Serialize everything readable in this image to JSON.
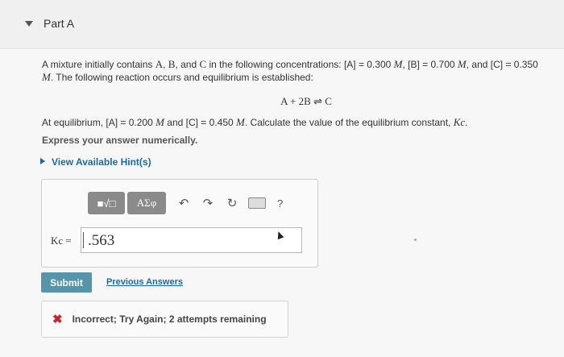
{
  "header": {
    "title": "Part A"
  },
  "problem": {
    "p1_intro": "A mixture initially contains ",
    "species": [
      "A",
      "B",
      "C"
    ],
    "p1_mid": " in the following concentrations: ",
    "conc_init": {
      "A": "0.300",
      "B": "0.700",
      "C": "0.350"
    },
    "unit": "M",
    "p1_end": ". The following reaction occurs and equilibrium is established:",
    "reaction": "A + 2B ⇌ C",
    "p2_start": "At equilibrium, ",
    "conc_eq": {
      "A": "0.200",
      "C": "0.450"
    },
    "p2_end": ". Calculate the value of the equilibrium constant, ",
    "kc": "Kc",
    "instruction": "Express your answer numerically."
  },
  "hint_label": "View Available Hint(s)",
  "toolbar": {
    "b1": "■√□",
    "b2": "ΑΣφ",
    "undo": "↶",
    "redo": "↷",
    "reset": "↻",
    "help": "?"
  },
  "answer": {
    "label": "Kc =",
    "value": ".563"
  },
  "submit_label": "Submit",
  "previous_answers_label": "Previous Answers",
  "feedback": {
    "icon": "✖",
    "text": "Incorrect; Try Again; 2 attempts remaining"
  }
}
